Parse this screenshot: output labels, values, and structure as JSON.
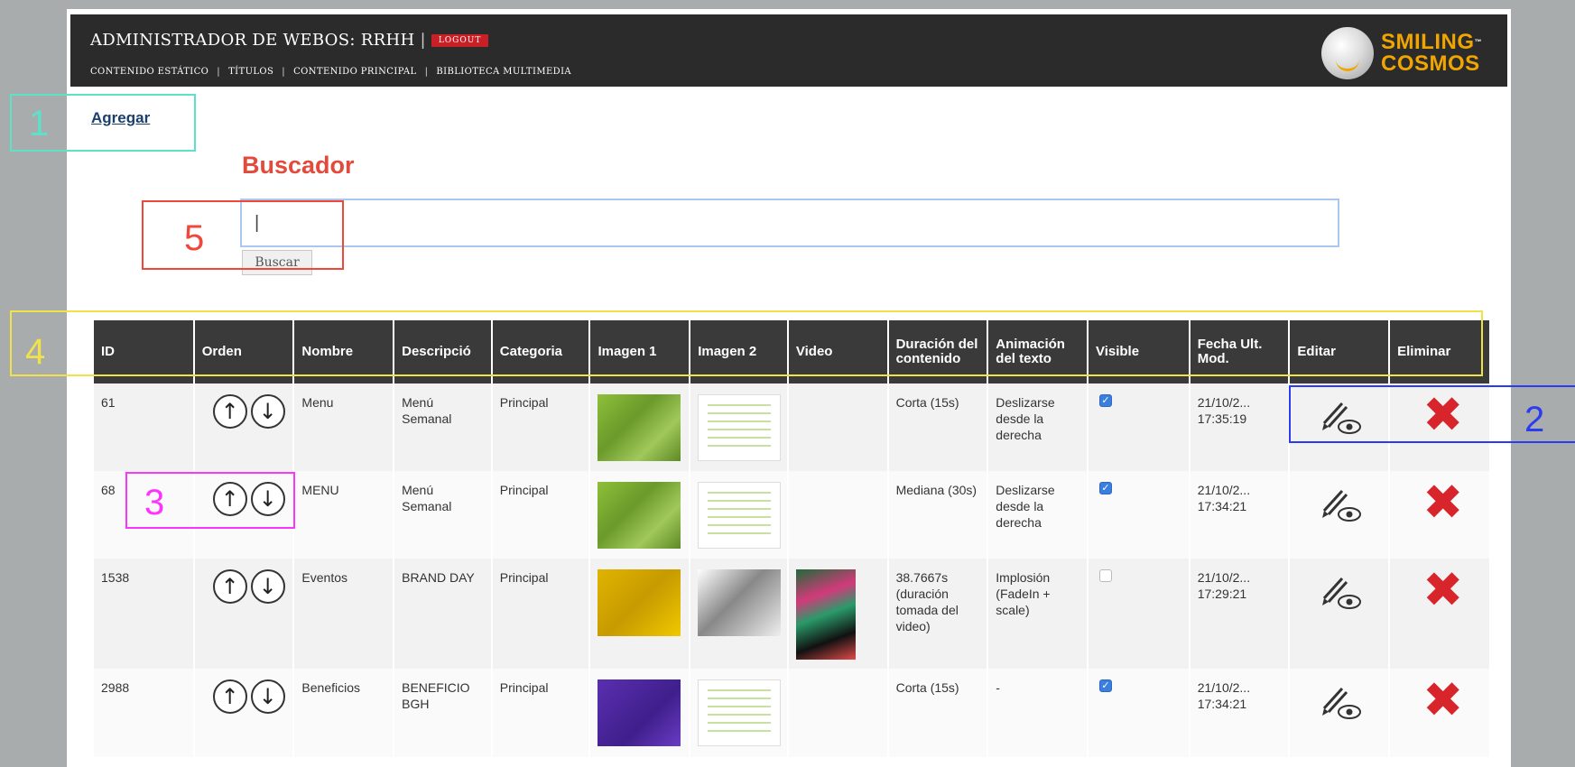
{
  "watermark": {
    "text": "SMILING COSMOS"
  },
  "header": {
    "title": "ADMINISTRADOR DE WEBOS: RRHH",
    "separator": "|",
    "logout_label": "LOGOUT",
    "nav": [
      {
        "label": "CONTENIDO ESTÁTICO"
      },
      {
        "label": "TÍTULOS"
      },
      {
        "label": "CONTENIDO PRINCIPAL"
      },
      {
        "label": "BIBLIOTECA MULTIMEDIA"
      }
    ],
    "nav_separator": "|",
    "logo": {
      "line1": "SMILING",
      "tm": "™",
      "line2": "COSMOS",
      "color": "#f0a500"
    }
  },
  "actions": {
    "add_label": "Agregar"
  },
  "search": {
    "title": "Buscador",
    "placeholder": "|",
    "button_label": "Buscar"
  },
  "annotations": {
    "n1": "1",
    "n2": "2",
    "n3": "3",
    "n4": "4",
    "n5": "5",
    "colors": {
      "n1": "#5fe0c8",
      "n2": "#2b3cf0",
      "n3": "#ff33ff",
      "n4": "#f2e24a",
      "n5": "#f0473a"
    }
  },
  "table": {
    "columns": [
      {
        "label": "ID"
      },
      {
        "label": "Orden"
      },
      {
        "label": "Nombre"
      },
      {
        "label": "Descripció"
      },
      {
        "label": "Categoria"
      },
      {
        "label": "Imagen 1"
      },
      {
        "label": "Imagen 2"
      },
      {
        "label": "Video"
      },
      {
        "label": "Duración del contenido"
      },
      {
        "label": "Animación del texto"
      },
      {
        "label": "Visible"
      },
      {
        "label": "Fecha Ult. Mod."
      },
      {
        "label": "Editar"
      },
      {
        "label": "Eliminar"
      }
    ],
    "arrow_up": "↑",
    "arrow_down": "↓",
    "check_mark": "✓",
    "delete_glyph": "✖",
    "rows": [
      {
        "id": "61",
        "nombre": "Menu",
        "descripcion": "Menú Semanal",
        "categoria": "Principal",
        "imagen1": "green-photo",
        "imagen2": "document-thumbnail",
        "video": "",
        "duracion": "Corta (15s)",
        "animacion": "Deslizarse desde la derecha",
        "visible": true,
        "fecha": "21/10/2... 17:35:19"
      },
      {
        "id": "68",
        "nombre": "MENU",
        "descripcion": "Menú Semanal",
        "categoria": "Principal",
        "imagen1": "green-photo",
        "imagen2": "document-thumbnail",
        "video": "",
        "duracion": "Mediana (30s)",
        "animacion": "Deslizarse desde la derecha",
        "visible": true,
        "fecha": "21/10/2... 17:34:21"
      },
      {
        "id": "1538",
        "nombre": "Eventos",
        "descripcion": "BRAND DAY",
        "categoria": "Principal",
        "imagen1": "yellow-photo",
        "imagen2": "gradient-thumbnail",
        "video": "video-thumbnail",
        "duracion": "38.7667s (duración tomada del video)",
        "animacion": "Implosión (FadeIn + scale)",
        "visible": false,
        "fecha": "21/10/2... 17:29:21"
      },
      {
        "id": "2988",
        "nombre": "Beneficios",
        "descripcion": "BENEFICIO BGH",
        "categoria": "Principal",
        "imagen1": "purple-photo",
        "imagen2": "document-thumbnail",
        "video": "",
        "duracion": "Corta (15s)",
        "animacion": "-",
        "visible": true,
        "fecha": "21/10/2... 17:34:21"
      }
    ]
  }
}
